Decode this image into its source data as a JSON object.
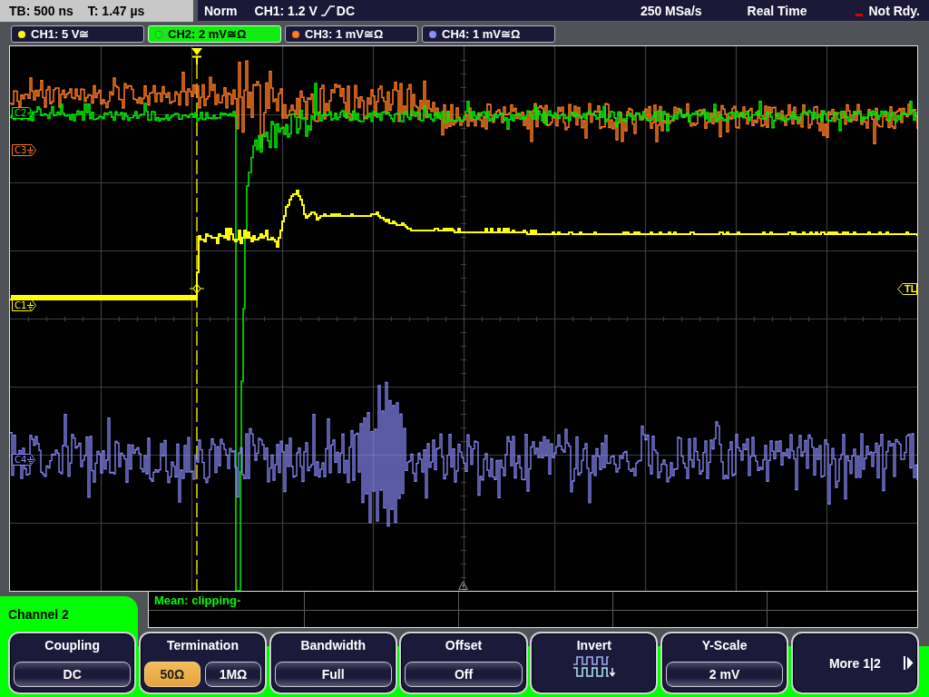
{
  "status_bar": {
    "timebase": "TB: 500 ns",
    "trigger_time": "T: 1.47 µs",
    "trigger_mode": "Norm",
    "trigger_source": "CH1: 1.2 V",
    "trigger_coupling": "DC",
    "sample_rate": "250 MSa/s",
    "acquisition": "Real Time",
    "status": "Not Rdy."
  },
  "channel_tabs": [
    {
      "label": "CH1: 5 V≅",
      "color": "#ffff00",
      "selected": false
    },
    {
      "label": "CH2: 2 mV≅Ω",
      "color": "#00ff00",
      "selected": true
    },
    {
      "label": "CH3: 1 mV≅Ω",
      "color": "#ff7a20",
      "selected": false
    },
    {
      "label": "CH4: 1 mV≅Ω",
      "color": "#8c8cff",
      "selected": false
    }
  ],
  "screen": {
    "traces": [
      {
        "kind": "step",
        "color": "#ffff00"
      },
      {
        "kind": "clipped",
        "color": "#00e600"
      },
      {
        "kind": "noise",
        "color": "#ff7a20"
      },
      {
        "kind": "burst",
        "color": "#8c8cff"
      }
    ],
    "markers": [
      {
        "label": "C2",
        "color": "#00ff00"
      },
      {
        "label": "C3",
        "color": "#ff7a20"
      },
      {
        "label": "C1",
        "color": "#ffff00"
      },
      {
        "label": "C4",
        "color": "#8c8cff"
      }
    ],
    "trigger_level_label": "TL"
  },
  "menu_title": "Channel 2",
  "measurement": {
    "readout": "Mean: clipping-"
  },
  "softkeys": [
    {
      "kind": "value",
      "label": "Coupling",
      "value": "DC"
    },
    {
      "kind": "options",
      "label": "Termination",
      "options": [
        {
          "label": "50Ω",
          "selected": true
        },
        {
          "label": "1MΩ",
          "selected": false
        }
      ]
    },
    {
      "kind": "value",
      "label": "Bandwidth",
      "value": "Full"
    },
    {
      "kind": "value",
      "label": "Offset",
      "value": "Off"
    },
    {
      "kind": "icon",
      "label": "Invert"
    },
    {
      "kind": "value",
      "label": "Y-Scale",
      "value": "2 mV"
    },
    {
      "kind": "page",
      "label": "More 1|2"
    }
  ]
}
